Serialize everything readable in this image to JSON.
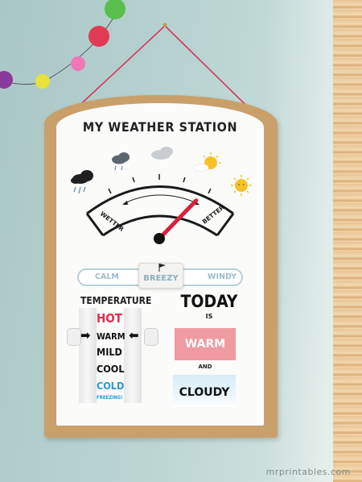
{
  "poster": {
    "title": "MY WEATHER STATION",
    "gauge": {
      "left_label": "WETTER",
      "right_label": "BETTER",
      "needle_level": 0.72,
      "icons": [
        "storm-cloud-icon",
        "rain-cloud-icon",
        "grey-cloud-icon",
        "sun-cloud-icon",
        "sun-icon"
      ]
    },
    "wind": {
      "left_label": "CALM",
      "selected_label": "BREEZY",
      "right_label": "WINDY"
    },
    "temperature": {
      "heading": "TEMPERATURE",
      "levels": [
        "HOT",
        "WARM",
        "MILD",
        "COOL",
        "COLD",
        "FREEZING!"
      ],
      "selected": "WARM"
    },
    "today": {
      "heading": "TODAY",
      "is_word": "IS",
      "temperature_word": "WARM",
      "and_word": "AND",
      "sky_word": "CLOUDY"
    }
  },
  "watermark": "mrprintables.com",
  "colors": {
    "wall": "#b8d3d1",
    "board": "#c9a06a",
    "hot": "#d9324f",
    "cold": "#2a98d6",
    "warm_card": "#f09aa1",
    "needle": "#d8203a",
    "wind_text": "#9fbcca"
  }
}
